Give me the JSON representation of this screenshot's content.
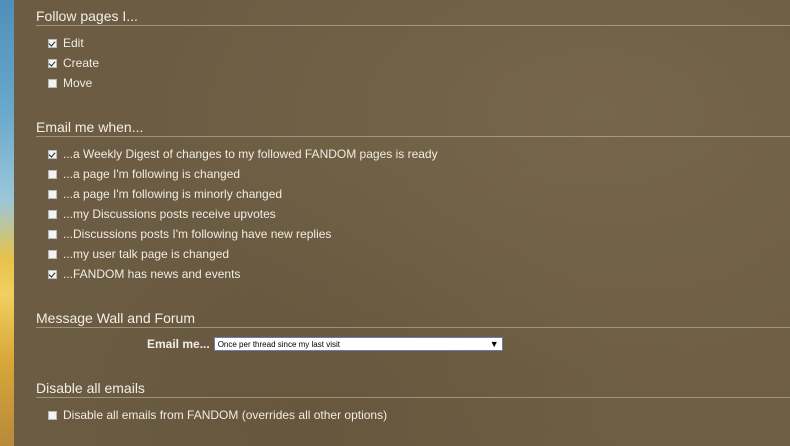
{
  "follow": {
    "title": "Follow pages I...",
    "options": [
      {
        "label": "Edit",
        "checked": true
      },
      {
        "label": "Create",
        "checked": true
      },
      {
        "label": "Move",
        "checked": false
      }
    ]
  },
  "email_when": {
    "title": "Email me when...",
    "options": [
      {
        "label": "...a Weekly Digest of changes to my followed FANDOM pages is ready",
        "checked": true
      },
      {
        "label": "...a page I'm following is changed",
        "checked": false
      },
      {
        "label": "...a page I'm following is minorly changed",
        "checked": false
      },
      {
        "label": "...my Discussions posts receive upvotes",
        "checked": false
      },
      {
        "label": "...Discussions posts I'm following have new replies",
        "checked": false
      },
      {
        "label": "...my user talk page is changed",
        "checked": false
      },
      {
        "label": "...FANDOM has news and events",
        "checked": true
      }
    ]
  },
  "message_wall": {
    "title": "Message Wall and Forum",
    "email_label": "Email me...",
    "selected_option": "Once per thread since my last visit",
    "arrow_icon": "▼"
  },
  "disable": {
    "title": "Disable all emails",
    "options": [
      {
        "label": "Disable all emails from FANDOM (overrides all other options)",
        "checked": false
      }
    ]
  }
}
